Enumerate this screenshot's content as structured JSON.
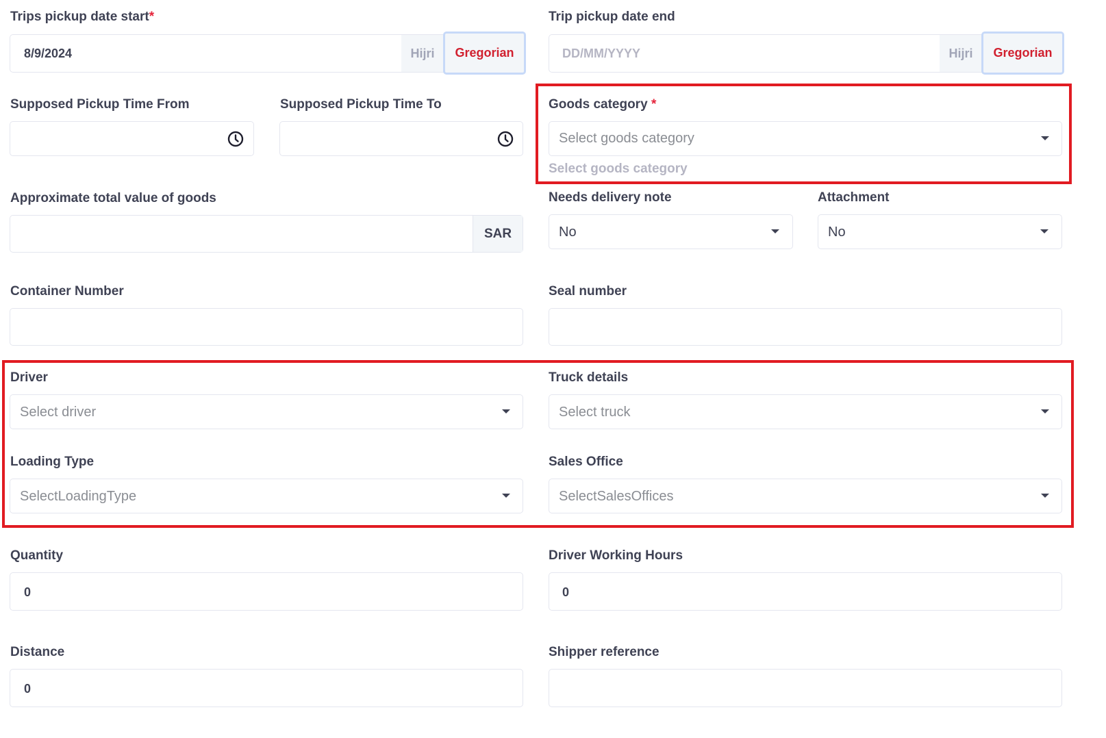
{
  "trip_start": {
    "label": "Trips pickup date start",
    "required_mark": "*",
    "value": "8/9/2024",
    "hijri_label": "Hijri",
    "gregorian_label": "Gregorian"
  },
  "trip_end": {
    "label": "Trip pickup date end",
    "placeholder": "DD/MM/YYYY",
    "hijri_label": "Hijri",
    "gregorian_label": "Gregorian"
  },
  "time_from": {
    "label": "Supposed Pickup Time From",
    "icon": "clock-icon"
  },
  "time_to": {
    "label": "Supposed Pickup Time To",
    "icon": "clock-icon"
  },
  "goods_category": {
    "label": "Goods category",
    "required_mark": "*",
    "placeholder": "Select goods category",
    "hint": "Select goods category"
  },
  "goods_value": {
    "label": "Approximate total value of goods",
    "currency": "SAR"
  },
  "delivery_note": {
    "label": "Needs delivery note",
    "value": "No"
  },
  "attachment": {
    "label": "Attachment",
    "value": "No"
  },
  "container_number": {
    "label": "Container Number"
  },
  "seal_number": {
    "label": "Seal number"
  },
  "driver": {
    "label": "Driver",
    "placeholder": "Select driver"
  },
  "truck": {
    "label": "Truck details",
    "placeholder": "Select truck"
  },
  "loading_type": {
    "label": "Loading Type",
    "placeholder": "SelectLoadingType"
  },
  "sales_office": {
    "label": "Sales Office",
    "placeholder": "SelectSalesOffices"
  },
  "quantity": {
    "label": "Quantity",
    "value": "0"
  },
  "driver_hours": {
    "label": "Driver Working Hours",
    "value": "0"
  },
  "distance": {
    "label": "Distance",
    "value": "0"
  },
  "shipper_reference": {
    "label": "Shipper reference"
  },
  "colors": {
    "highlight": "#e11b22",
    "required": "#e5243b",
    "gregorian_text": "#d1202f",
    "input_border": "#e4e6ef"
  }
}
